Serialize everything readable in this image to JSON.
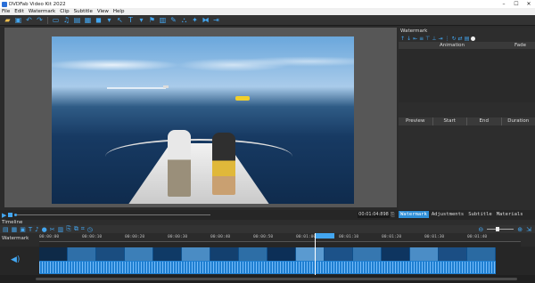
{
  "window": {
    "title": "DVDFab Video Kit 2022",
    "controls": [
      "–",
      "☐",
      "✕"
    ]
  },
  "menu": [
    "File",
    "Edit",
    "Watermark",
    "Clip",
    "Subtitle",
    "View",
    "Help"
  ],
  "watermark_panel": {
    "title": "Watermark",
    "columns_top": [
      "Animation",
      "Fade"
    ],
    "columns_bottom": [
      "Preview",
      "Start",
      "End",
      "Duration"
    ]
  },
  "transport": {
    "timecode": "00:01:04:898"
  },
  "tabs": [
    {
      "label": "Watermark",
      "active": true
    },
    {
      "label": "Adjustments",
      "active": false
    },
    {
      "label": "Subtitle",
      "active": false
    },
    {
      "label": "Materials",
      "active": false
    }
  ],
  "timeline": {
    "label": "Timeline",
    "track_name": "Watermark",
    "ticks": [
      "00:00:00",
      "00:00:10",
      "00:00:20",
      "00:00:30",
      "00:00:40",
      "00:00:50",
      "00:01:00",
      "00:01:10",
      "00:01:20",
      "00:01:30",
      "00:01:40"
    ]
  },
  "colors": {
    "accent": "#43a6f0",
    "clip": "#1f7fd1",
    "active_tab": "#2f8fd8"
  }
}
